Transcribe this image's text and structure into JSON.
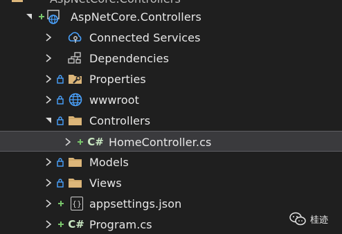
{
  "top_partial": {
    "label": "AspNetCore.Controllers"
  },
  "project": {
    "label": "AspNetCore.Controllers"
  },
  "items": [
    {
      "label": "Connected Services"
    },
    {
      "label": "Dependencies"
    },
    {
      "label": "Properties"
    },
    {
      "label": "wwwroot"
    },
    {
      "label": "Controllers"
    },
    {
      "label": "HomeController.cs",
      "icon_text": "C#"
    },
    {
      "label": "Models"
    },
    {
      "label": "Views"
    },
    {
      "label": "appsettings.json",
      "icon_text": "{}"
    },
    {
      "label": "Program.cs",
      "icon_text": "C#"
    }
  ],
  "colors": {
    "background": "#1f1f1f",
    "text": "#e8e8e8",
    "selection": "#3a3a3d",
    "folder": "#dcb67a",
    "add_plus": "#79c56b",
    "lock": "#4aa3ff",
    "globe": "#4aa3ff"
  },
  "watermark": {
    "text": "桂迹"
  }
}
